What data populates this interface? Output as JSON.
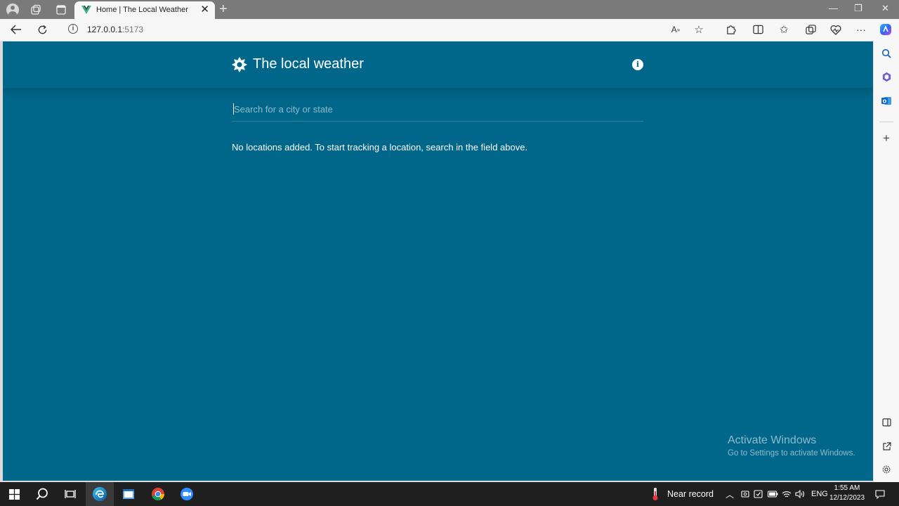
{
  "browser": {
    "tab_title": "Home | The Local Weather",
    "tab_close": "✕",
    "new_tab": "+",
    "url_host": "127.0.0.1",
    "url_port": ":5173",
    "window_controls": {
      "minimize": "—",
      "restore": "❐",
      "close": "✕"
    },
    "toolbar_icons": [
      "back-icon",
      "refresh-icon",
      "read-aloud-icon",
      "favorite-icon",
      "extensions-icon",
      "split-screen-icon",
      "favorites-icon",
      "collections-icon",
      "browser-essentials-icon",
      "more-icon",
      "copilot-icon"
    ],
    "sidebar_icons": [
      "search-icon",
      "office-icon",
      "outlook-icon",
      "add-icon",
      "sidebar-toggle-icon",
      "open-external-icon",
      "settings-icon"
    ]
  },
  "app": {
    "title": "The local weather",
    "search_placeholder": "Search for a city or state",
    "empty_message": "No locations added. To start tracking a location, search in the field above.",
    "info_glyph": "i",
    "bg_color": "#00668a"
  },
  "watermark": {
    "line1": "Activate Windows",
    "line2": "Go to Settings to activate Windows."
  },
  "taskbar": {
    "weather_text": "Near record",
    "language": "ENG",
    "time": "1:55 AM",
    "date": "12/12/2023"
  }
}
